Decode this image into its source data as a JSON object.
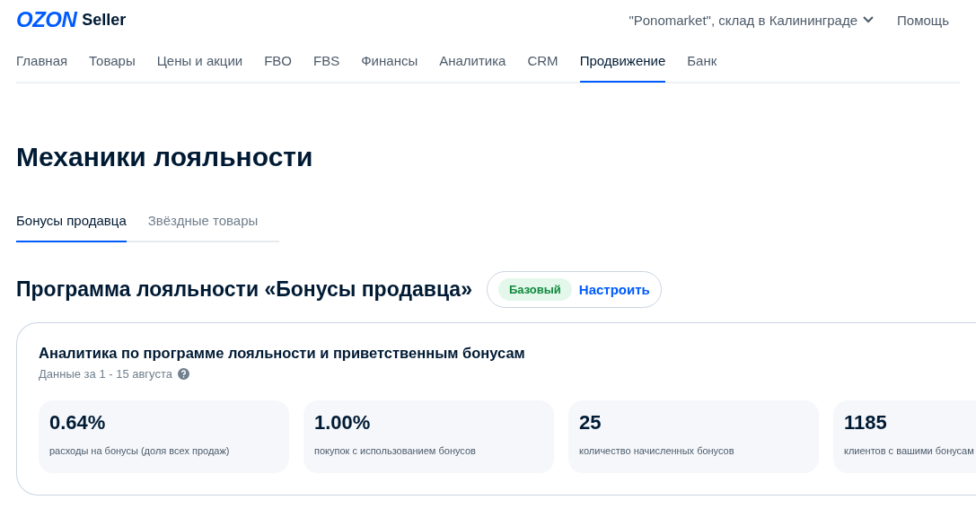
{
  "header": {
    "logo": "OZON",
    "logo_suffix": "Seller",
    "store": "\"Ponomarket\", склад в Калининграде",
    "help": "Помощь"
  },
  "nav": [
    {
      "label": "Главная",
      "selected": false
    },
    {
      "label": "Товары",
      "selected": false
    },
    {
      "label": "Цены и акции",
      "selected": false
    },
    {
      "label": "FBO",
      "selected": false
    },
    {
      "label": "FBS",
      "selected": false
    },
    {
      "label": "Финансы",
      "selected": false
    },
    {
      "label": "Аналитика",
      "selected": false
    },
    {
      "label": "CRM",
      "selected": false
    },
    {
      "label": "Продвижение",
      "selected": true
    },
    {
      "label": "Банк",
      "selected": false
    }
  ],
  "page_title": "Механики лояльности",
  "tabs": [
    {
      "label": "Бонусы продавца",
      "selected": true
    },
    {
      "label": "Звёздные товары",
      "selected": false
    }
  ],
  "program": {
    "title": "Программа лояльности «Бонусы продавца»",
    "badge": "Базовый",
    "action": "Настроить"
  },
  "analytics": {
    "title": "Аналитика по программе лояльности и приветственным бонусам",
    "period": "Данные за 1 - 15 августа",
    "metrics": [
      {
        "value": "0.64%",
        "label": "расходы на бонусы (доля всех продаж)"
      },
      {
        "value": "1.00%",
        "label": "покупок с использованием бонусов"
      },
      {
        "value": "25",
        "label": "количество начисленных бонусов"
      },
      {
        "value": "1185",
        "label": "клиентов с вашими бонусам"
      }
    ]
  }
}
